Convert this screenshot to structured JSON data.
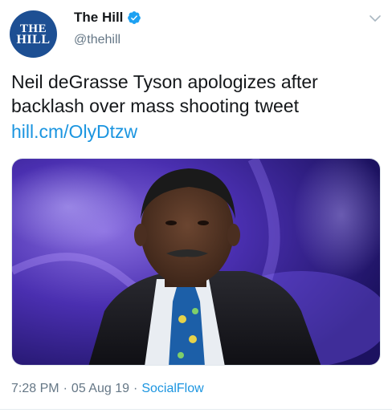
{
  "author": {
    "avatar_line1": "THE",
    "avatar_line2": "HILL",
    "display_name": "The Hill",
    "handle": "@thehill",
    "verified": true
  },
  "tweet": {
    "text": "Neil deGrasse Tyson apologizes after backlash over mass shooting tweet",
    "link": "hill.cm/OlyDtzw",
    "time": "7:28 PM",
    "date": "05 Aug 19",
    "source": "SocialFlow",
    "separator": "·"
  },
  "icons": {
    "verified": "verified-badge-icon",
    "menu": "chevron-down-icon"
  },
  "colors": {
    "accent": "#1b95e0",
    "avatar_bg": "#1d4f93",
    "muted": "#657786"
  }
}
